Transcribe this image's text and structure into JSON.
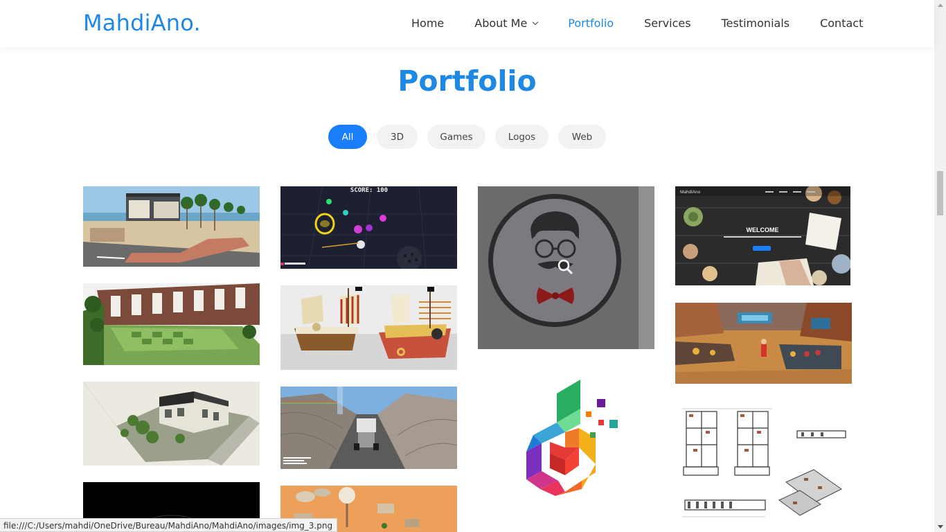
{
  "brand": "MahdiAno.",
  "nav": {
    "items": [
      {
        "label": "Home",
        "active": false
      },
      {
        "label": "About Me",
        "active": false,
        "dropdown": true
      },
      {
        "label": "Portfolio",
        "active": true
      },
      {
        "label": "Services",
        "active": false
      },
      {
        "label": "Testimonials",
        "active": false
      },
      {
        "label": "Contact",
        "active": false
      }
    ]
  },
  "section": {
    "title": "Portfolio"
  },
  "filters": [
    {
      "label": "All",
      "active": true
    },
    {
      "label": "3D",
      "active": false
    },
    {
      "label": "Games",
      "active": false
    },
    {
      "label": "Logos",
      "active": false
    },
    {
      "label": "Web",
      "active": false
    }
  ],
  "items": {
    "game_score": "SCORE: 100",
    "web_welcome": "WELCOME",
    "web_brand": "MahdiAno"
  },
  "status_url": "file:///C:/Users/mahdi/OneDrive/Bureau/MahdiAno/MahdiAno/images/img_3.png",
  "colors": {
    "accent": "#1e88e5",
    "filter_active": "#1a7efb",
    "filter_bg": "#f1f2f3"
  }
}
